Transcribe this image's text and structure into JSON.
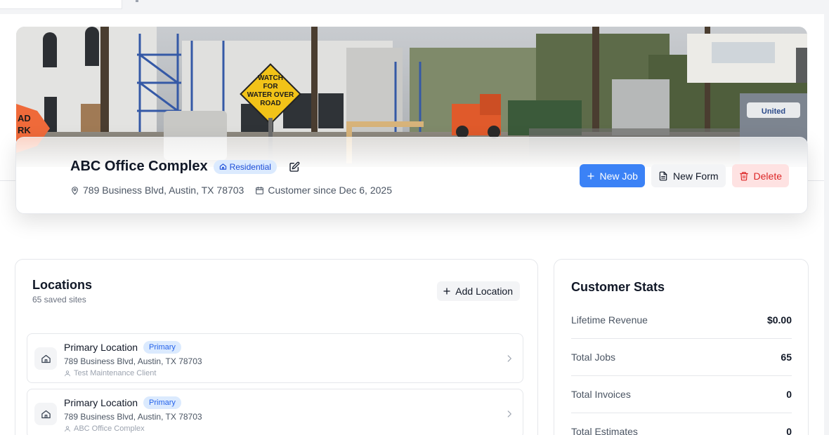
{
  "customer": {
    "name": "ABC Office Complex",
    "type_badge": "Residential",
    "address": "789 Business Blvd, Austin, TX 78703",
    "customer_since": "Customer since Dec 6, 2025"
  },
  "actions": {
    "new_job": "New Job",
    "new_form": "New Form",
    "delete": "Delete"
  },
  "banner": {
    "sign_left": "AD\nRK",
    "sign_center": "WATCH\nFOR\nWATER OVER\nROAD",
    "portable_toilet_logo": "United"
  },
  "locations": {
    "title": "Locations",
    "subtitle": "65 saved sites",
    "add_label": "Add Location",
    "items": [
      {
        "name": "Primary Location",
        "badge": "Primary",
        "address": "789 Business Blvd, Austin, TX 78703",
        "contact": "Test Maintenance Client"
      },
      {
        "name": "Primary Location",
        "badge": "Primary",
        "address": "789 Business Blvd, Austin, TX 78703",
        "contact": "ABC Office Complex"
      }
    ]
  },
  "stats": {
    "title": "Customer Stats",
    "rows": [
      {
        "label": "Lifetime Revenue",
        "value": "$0.00"
      },
      {
        "label": "Total Jobs",
        "value": "65"
      },
      {
        "label": "Total Invoices",
        "value": "0"
      },
      {
        "label": "Total Estimates",
        "value": "0"
      }
    ]
  },
  "colors": {
    "accent": "#3b82f6",
    "danger": "#dc2626",
    "badge_bg": "#dbeafe"
  },
  "icons": {
    "badge": "home-icon",
    "edit": "edit-icon",
    "address": "map-pin-icon",
    "since": "calendar-icon",
    "new_job": "plus-icon",
    "new_form": "document-icon",
    "delete": "trash-icon",
    "location": "home-icon",
    "contact": "user-icon",
    "open": "chevron-right-icon"
  }
}
